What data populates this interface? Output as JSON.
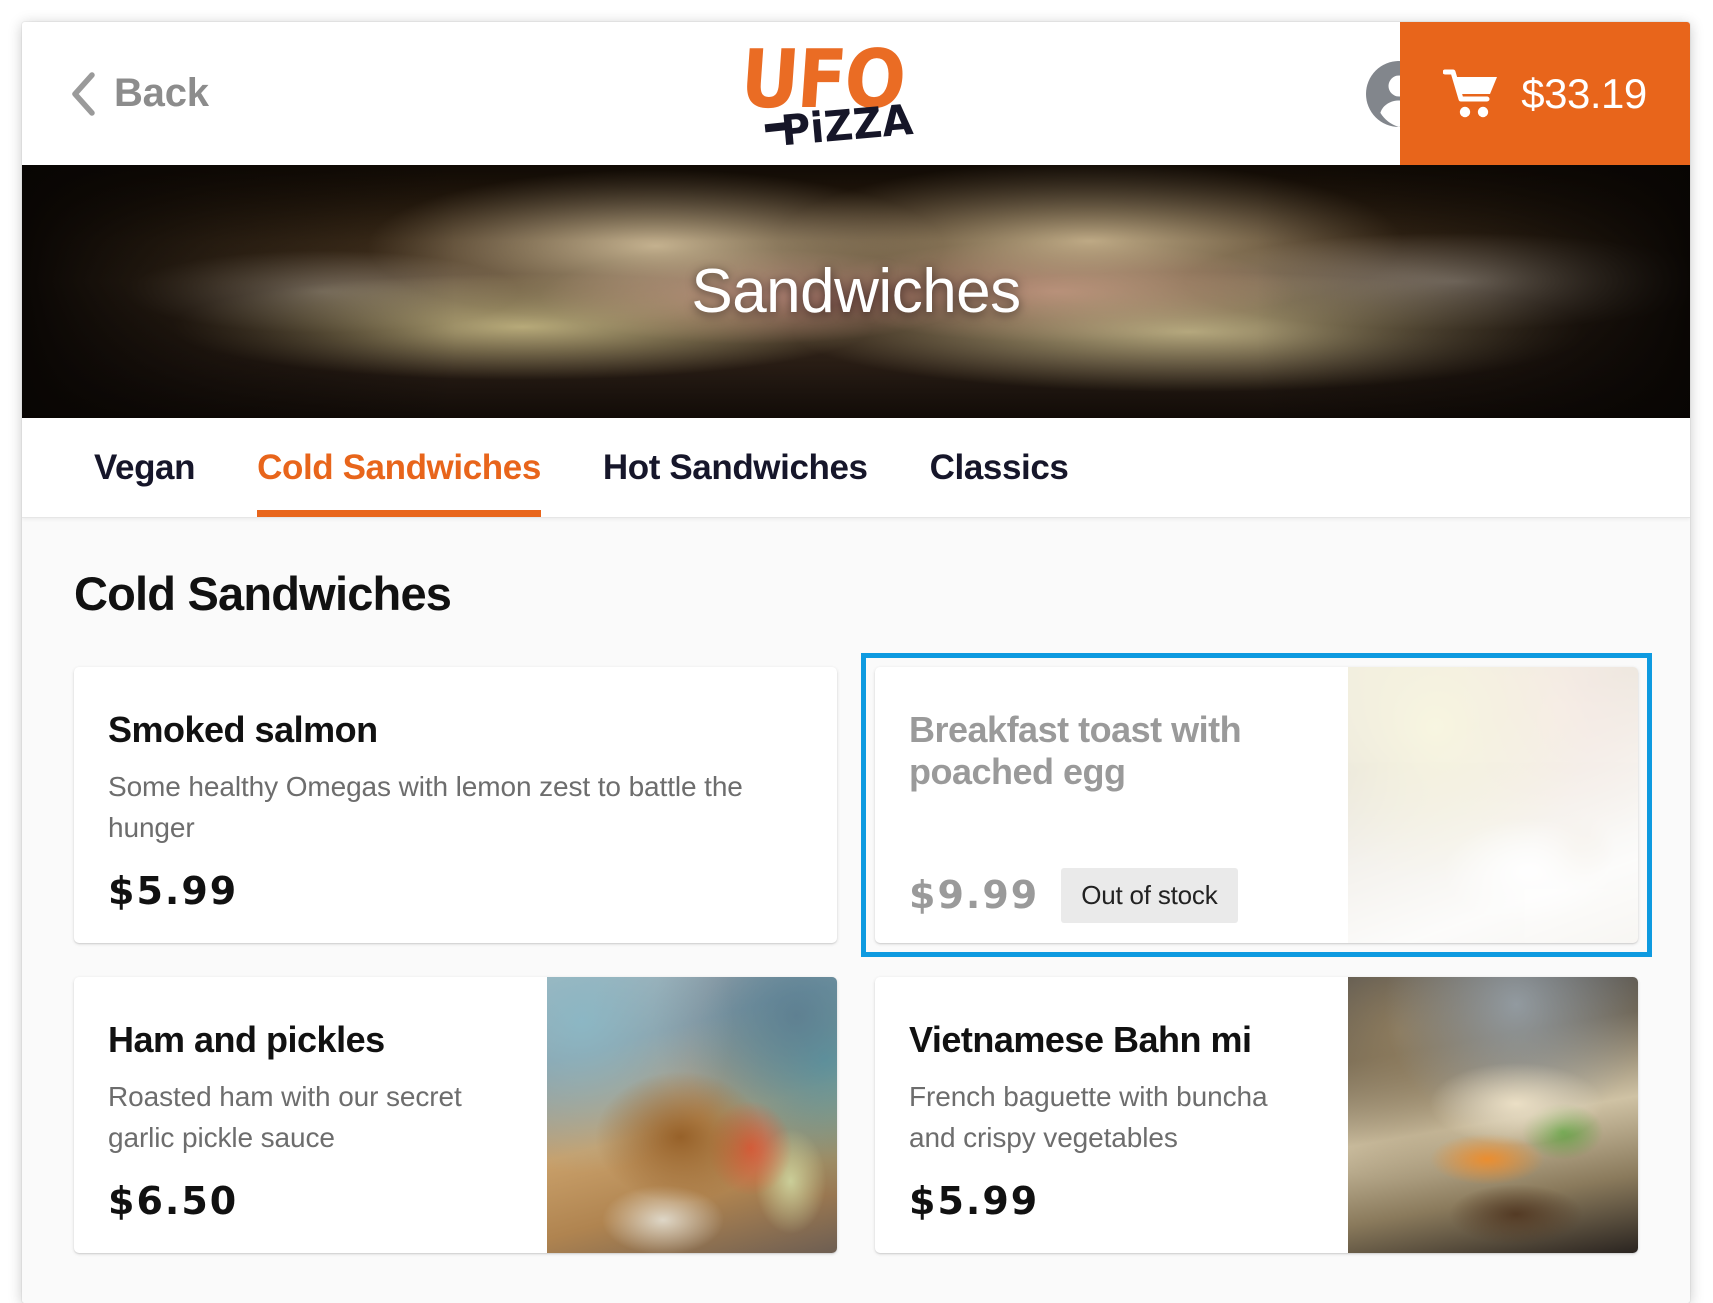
{
  "topbar": {
    "back_label": "Back",
    "back_icon": "chevron-left-icon",
    "logo_primary": "UFO",
    "logo_secondary": "PiZZA",
    "account_icon": "account-circle-icon",
    "cart_icon": "shopping-cart-icon",
    "cart_total": "$33.19",
    "brand_orange": "#e8651b"
  },
  "hero": {
    "title": "Sandwiches"
  },
  "tabs": [
    {
      "label": "Vegan",
      "active": false
    },
    {
      "label": "Cold Sandwiches",
      "active": true
    },
    {
      "label": "Hot Sandwiches",
      "active": false
    },
    {
      "label": "Classics",
      "active": false
    }
  ],
  "main": {
    "section_title": "Cold Sandwiches",
    "selection_color": "#0e9ae0",
    "items": [
      {
        "name": "Smoked salmon",
        "description": "Some healthy Omegas with lemon zest to battle the hunger",
        "price": "$5.99",
        "badge": "",
        "has_photo": false,
        "out_of_stock": false,
        "selected": false
      },
      {
        "name": "Breakfast toast with poached egg",
        "description": "",
        "price": "$9.99",
        "badge": "Out of stock",
        "has_photo": true,
        "out_of_stock": true,
        "selected": true
      },
      {
        "name": "Ham and pickles",
        "description": "Roasted ham with our secret garlic pickle sauce",
        "price": "$6.50",
        "badge": "",
        "has_photo": true,
        "out_of_stock": false,
        "selected": false
      },
      {
        "name": "Vietnamese Bahn mi",
        "description": "French baguette with buncha and crispy vegetables",
        "price": "$5.99",
        "badge": "",
        "has_photo": true,
        "out_of_stock": false,
        "selected": false
      }
    ]
  }
}
